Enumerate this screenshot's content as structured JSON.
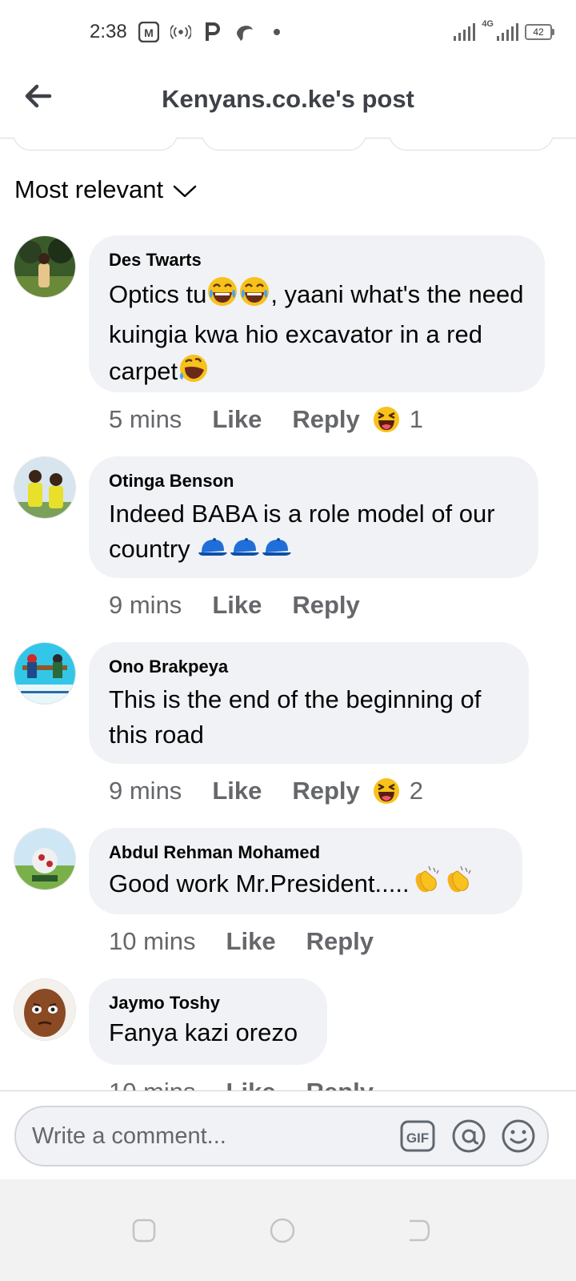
{
  "status_bar": {
    "time": "2:38",
    "icons": [
      "app-m-icon",
      "hotspot-icon",
      "parking-p-icon",
      "shell-icon",
      "dot-icon"
    ],
    "network_label": "4G",
    "battery_level": "42"
  },
  "header": {
    "title": "Kenyans.co.ke's post",
    "back_icon": "arrow-left-icon"
  },
  "sort": {
    "label": "Most relevant"
  },
  "comments": [
    {
      "author": "Des Twarts",
      "text_parts": [
        "Optics tu",
        ", yaani what's the need kuingia kwa hio excavator in a red carpet"
      ],
      "emojis": [
        "laugh-tears-emoji",
        "laugh-tears-emoji",
        "rolling-laugh-emoji"
      ],
      "time": "5 mins",
      "like": "Like",
      "reply": "Reply",
      "reaction_count": "1",
      "reaction": "haha"
    },
    {
      "author": "Otinga Benson",
      "text": "Indeed BABA is a role model of our country",
      "emojis": [
        "blue-cap-emoji",
        "blue-cap-emoji",
        "blue-cap-emoji"
      ],
      "time": "9 mins",
      "like": "Like",
      "reply": "Reply"
    },
    {
      "author": "Ono Brakpeya",
      "text": "This is the end of the beginning of this road",
      "time": "9 mins",
      "like": "Like",
      "reply": "Reply",
      "reaction_count": "2",
      "reaction": "haha"
    },
    {
      "author": "Abdul Rehman Mohamed",
      "text": "Good work Mr.President.....",
      "emojis": [
        "clapping-hands-emoji",
        "clapping-hands-emoji"
      ],
      "time": "10 mins",
      "like": "Like",
      "reply": "Reply"
    },
    {
      "author": "Jaymo Toshy",
      "text": "Fanya kazi orezo",
      "time": "10 mins",
      "like": "Like",
      "reply": "Reply"
    }
  ],
  "composer": {
    "placeholder": "Write a comment...",
    "gif_label": "GIF"
  },
  "colors": {
    "bubble": "#f0f2f5",
    "meta_text": "#65676b",
    "emoji_yellow": "#f7c21b",
    "cap_blue": "#1e6fd9"
  }
}
